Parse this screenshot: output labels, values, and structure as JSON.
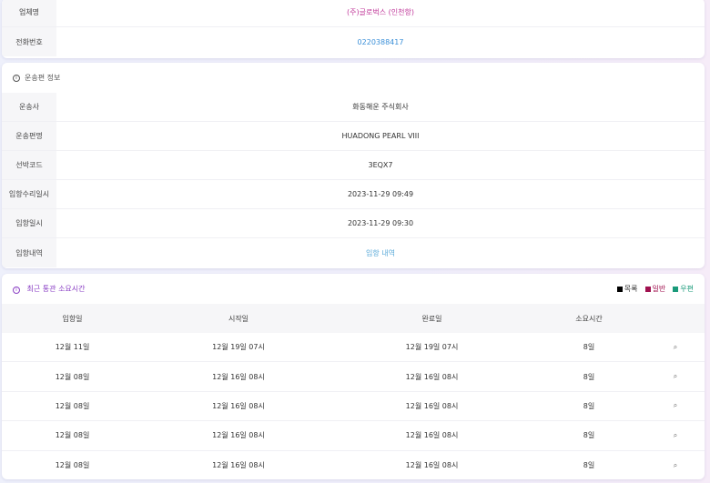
{
  "company_card": {
    "rows": [
      {
        "label": "업체명",
        "value": "(주)글로벅스 (인천항)"
      },
      {
        "label": "전화번호",
        "value": "0220388417"
      }
    ]
  },
  "vessel_card": {
    "title_icon": "①",
    "title": "운송편 정보",
    "rows": [
      {
        "label": "운송사",
        "value": "화동해운 주식회사"
      },
      {
        "label": "운송편명",
        "value": "HUADONG PEARL VIII"
      },
      {
        "label": "선박코드",
        "value": "3EQX7"
      },
      {
        "label": "입항수리일시",
        "value": "2023-11-29 09:49"
      },
      {
        "label": "입항일시",
        "value": "2023-11-29 09:30"
      },
      {
        "label": "입항내역",
        "value": "입항 내역"
      }
    ]
  },
  "customs_card": {
    "title_icon": "①",
    "title": "최근 통관 소요시간",
    "legend": [
      {
        "label": "목록",
        "color": "#000000"
      },
      {
        "label": "일반",
        "color": "#a0114f"
      },
      {
        "label": "우편",
        "color": "#1a9a7a"
      }
    ],
    "headers": [
      "입항일",
      "시작일",
      "완료일",
      "소요시간"
    ],
    "rows": [
      [
        "12월 11일",
        "12월 19일 07시",
        "12월 19일 07시",
        "8일"
      ],
      [
        "12월 08일",
        "12월 16일 08시",
        "12월 16일 08시",
        "8일"
      ],
      [
        "12월 08일",
        "12월 16일 08시",
        "12월 16일 08시",
        "8일"
      ],
      [
        "12월 08일",
        "12월 16일 08시",
        "12월 16일 08시",
        "8일"
      ],
      [
        "12월 08일",
        "12월 16일 08시",
        "12월 16일 08시",
        "8일"
      ]
    ],
    "detail_icon": "🔍"
  }
}
